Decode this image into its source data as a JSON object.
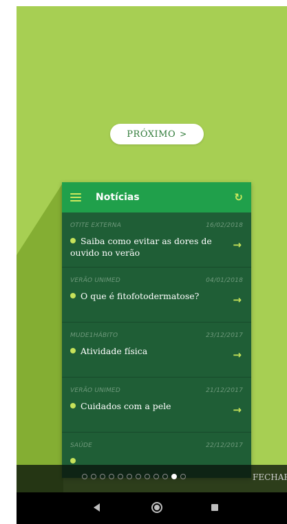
{
  "intro": {
    "next_label": "PRÓXIMO",
    "next_chevron": ">",
    "close_label": "FECHAR",
    "pager_total": 12,
    "pager_active_index": 10
  },
  "app": {
    "title": "Notícias",
    "menu_icon": "hamburger-menu-icon",
    "refresh_icon": "refresh-icon",
    "arrow_icon": "arrow-right-icon"
  },
  "news": [
    {
      "category": "OTITE EXTERNA",
      "date": "16/02/2018",
      "headline": "Saiba como evitar as dores de ouvido no verão"
    },
    {
      "category": "VERÃO UNIMED",
      "date": "04/01/2018",
      "headline": "O que é fitofotodermatose?"
    },
    {
      "category": "MUDE1HÁBITO",
      "date": "23/12/2017",
      "headline": "Atividade física"
    },
    {
      "category": "VERÃO UNIMED",
      "date": "21/12/2017",
      "headline": "Cuidados com a pele"
    },
    {
      "category": "SAÚDE",
      "date": "22/12/2017",
      "headline": ""
    }
  ],
  "colors": {
    "background": "#a7cf53",
    "app_bar": "#20a04b",
    "list_bg": "#1f5e36",
    "accent": "#c6e25a"
  }
}
